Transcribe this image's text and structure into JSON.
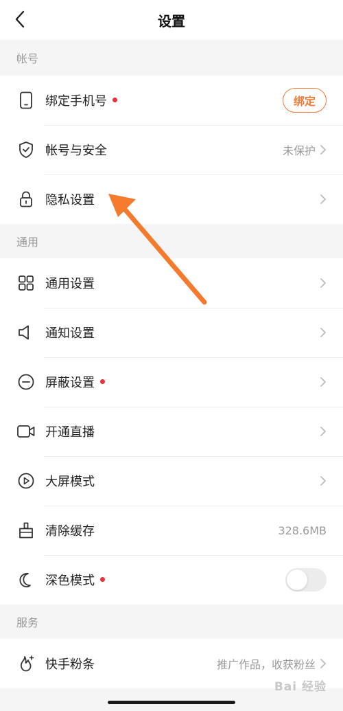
{
  "header": {
    "title": "设置"
  },
  "sections": {
    "account": "帐号",
    "general": "通用",
    "service": "服务"
  },
  "account": {
    "bind_phone": {
      "label": "绑定手机号",
      "button": "绑定"
    },
    "security": {
      "label": "帐号与安全",
      "status": "未保护"
    },
    "privacy": {
      "label": "隐私设置"
    }
  },
  "general": {
    "general_settings": {
      "label": "通用设置"
    },
    "notifications": {
      "label": "通知设置"
    },
    "block": {
      "label": "屏蔽设置"
    },
    "live": {
      "label": "开通直播"
    },
    "big_screen": {
      "label": "大屏模式"
    },
    "clear_cache": {
      "label": "清除缓存",
      "value": "328.6MB"
    },
    "dark_mode": {
      "label": "深色模式",
      "enabled": false
    }
  },
  "service": {
    "fans": {
      "label": "快手粉条",
      "desc": "推广作品，收获粉丝"
    }
  },
  "watermark": "Bai 经验",
  "colors": {
    "accent": "#f27b38",
    "badge": "#e8323c",
    "arrow": "#f47a2e"
  }
}
